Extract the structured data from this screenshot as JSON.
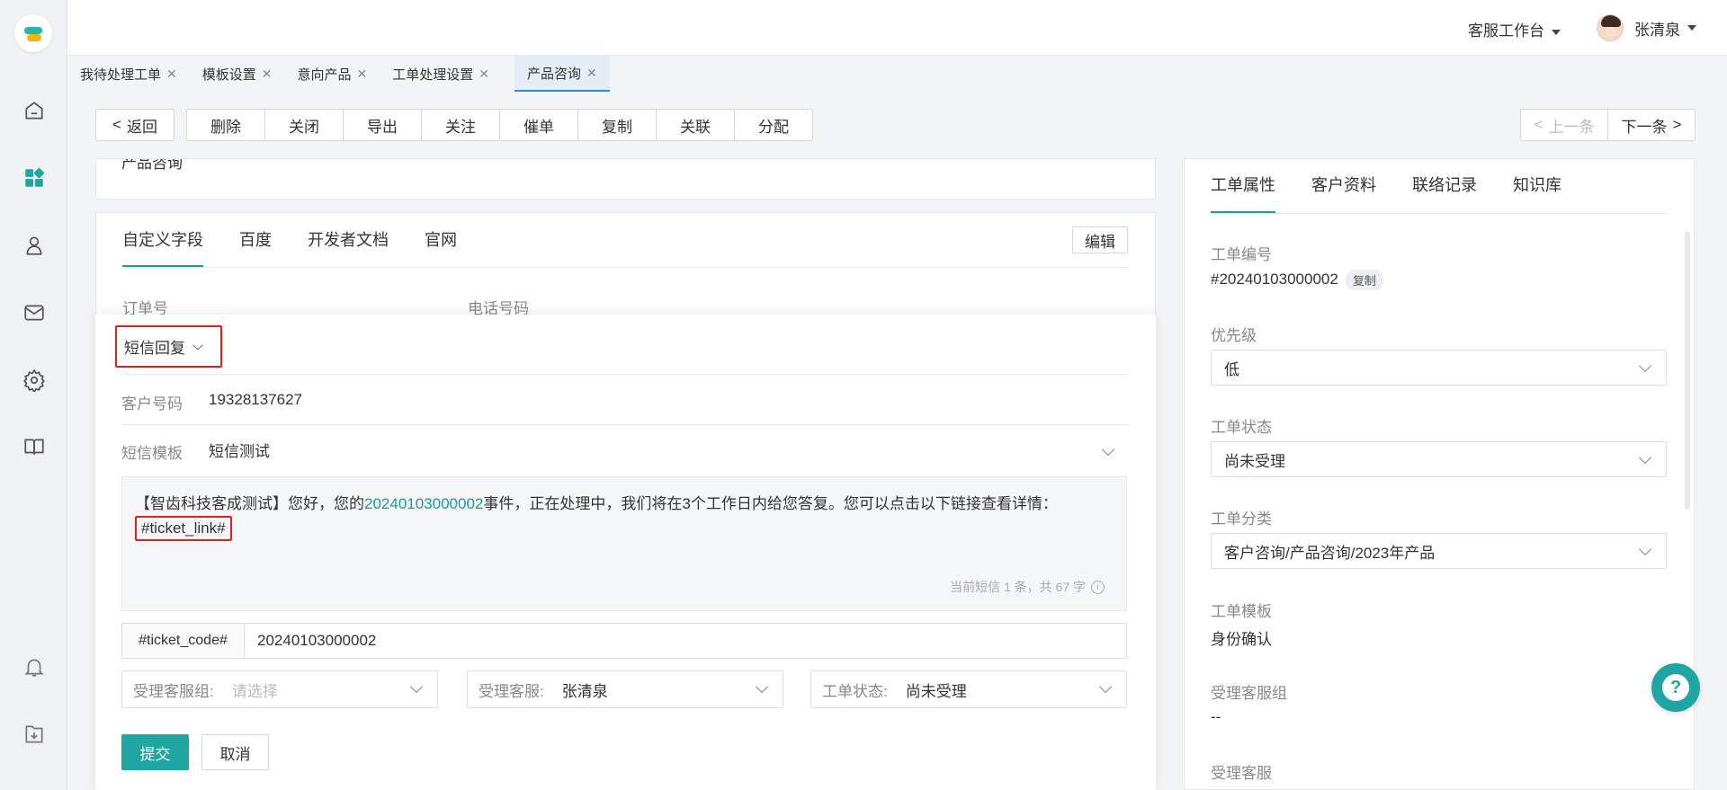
{
  "topbar": {
    "workspace": "客服工作台",
    "user_name": "张清泉"
  },
  "tabs": [
    {
      "label": "我待处理工单"
    },
    {
      "label": "模板设置"
    },
    {
      "label": "意向产品"
    },
    {
      "label": "工单处理设置"
    },
    {
      "label": "产品咨询"
    }
  ],
  "toolbar": {
    "back": "返回",
    "actions": [
      "删除",
      "关闭",
      "导出",
      "关注",
      "催单",
      "复制",
      "关联",
      "分配"
    ],
    "prev": "上一条",
    "next": "下一条"
  },
  "left": {
    "top_cut_text": "产品咨询",
    "sub_tabs": [
      "自定义字段",
      "百度",
      "开发者文档",
      "官网"
    ],
    "edit": "编辑",
    "field_order": "订单号",
    "field_phone": "电话号码"
  },
  "sms": {
    "type": "短信回复",
    "customer_label": "客户号码",
    "customer_value": "19328137627",
    "template_label": "短信模板",
    "template_value": "短信测试",
    "msg_prefix": "【智齿科技客成测试】您好，您的",
    "msg_link": "20240103000002",
    "msg_suffix": "事件，正在处理中，我们将在3个工作日内给您答复。您可以点击以下链接查看详情：",
    "msg_tag": "#ticket_link#",
    "msg_count": "当前短信 1 条，共 67 字",
    "code_key": "#ticket_code#",
    "code_value": "20240103000002",
    "group_label": "受理客服组:",
    "group_placeholder": "请选择",
    "agent_label": "受理客服:",
    "agent_value": "张清泉",
    "status_label": "工单状态:",
    "status_value": "尚未受理",
    "submit": "提交",
    "cancel": "取消"
  },
  "right": {
    "tabs": [
      "工单属性",
      "客户资料",
      "联络记录",
      "知识库"
    ],
    "ticket_no_label": "工单编号",
    "ticket_no": "#20240103000002",
    "copy": "复制",
    "priority_label": "优先级",
    "priority": "低",
    "status_label": "工单状态",
    "status": "尚未受理",
    "category_label": "工单分类",
    "category": "客户咨询/产品咨询/2023年产品",
    "template_label": "工单模板",
    "template": "身份确认",
    "group_label": "受理客服组",
    "group": "--",
    "agent_label": "受理客服"
  },
  "colors": {
    "accent": "#1fa5a2",
    "highlight": "#e01f1f"
  }
}
